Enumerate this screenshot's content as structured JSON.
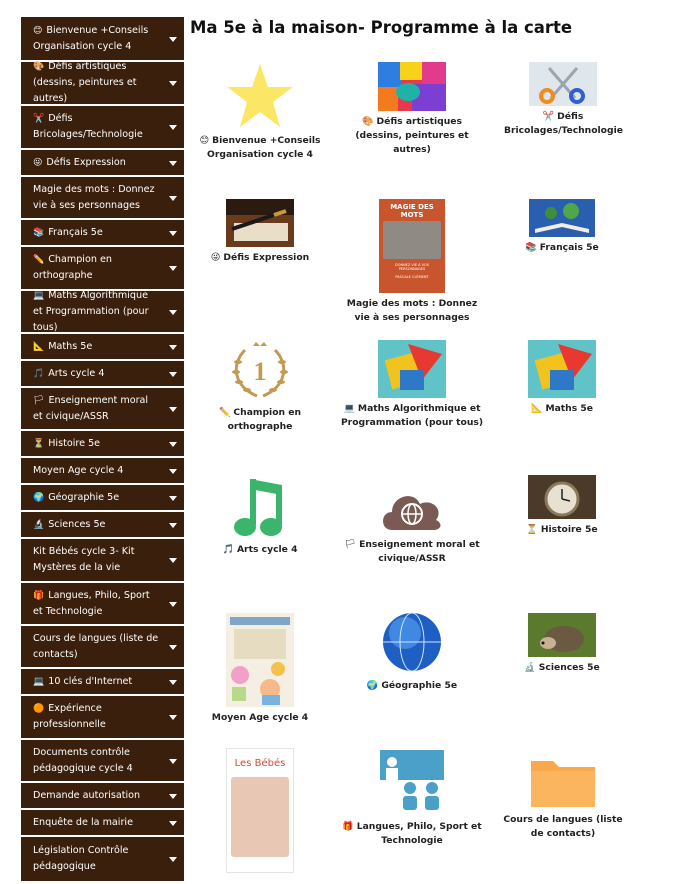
{
  "page": {
    "title": "Ma 5e à la maison- Programme à la carte"
  },
  "sidebar": {
    "items": [
      {
        "icon": "😊",
        "label": "Bienvenue +Conseils Organisation cycle 4"
      },
      {
        "icon": "🎨",
        "label": "Défis artistiques (dessins, peintures et autres)"
      },
      {
        "icon": "✂️",
        "label": "Défis Bricolages/Technologie"
      },
      {
        "icon": "😜",
        "label": "Défis Expression"
      },
      {
        "icon": "",
        "label": "Magie des mots : Donnez vie à ses personnages"
      },
      {
        "icon": "📚",
        "label": "Français 5e"
      },
      {
        "icon": "✏️",
        "label": "Champion en orthographe"
      },
      {
        "icon": "💻",
        "label": "Maths Algorithmique et Programmation (pour tous)"
      },
      {
        "icon": "📐",
        "label": "Maths 5e"
      },
      {
        "icon": "🎵",
        "label": "Arts cycle 4"
      },
      {
        "icon": "🏳",
        "label": "Enseignement moral et civique/ASSR"
      },
      {
        "icon": "⏳",
        "label": "Histoire 5e"
      },
      {
        "icon": "",
        "label": "Moyen Age cycle 4"
      },
      {
        "icon": "🌍",
        "label": "Géographie 5e"
      },
      {
        "icon": "🔬",
        "label": "Sciences 5e"
      },
      {
        "icon": "",
        "label": "Kit Bébés cycle 3- Kit Mystères de la vie"
      },
      {
        "icon": "🎁",
        "label": "Langues, Philo, Sport et Technologie"
      },
      {
        "icon": "",
        "label": "Cours de langues (liste de contacts)"
      },
      {
        "icon": "💻",
        "label": "10 clés d'Internet"
      },
      {
        "icon": "🟠",
        "label": "Expérience professionnelle"
      },
      {
        "icon": "",
        "label": "Documents contrôle pédagogique cycle 4"
      },
      {
        "icon": "",
        "label": "Demande autorisation"
      },
      {
        "icon": "",
        "label": "Enquête de la mairie"
      },
      {
        "icon": "",
        "label": "Législation Contrôle pédagogique"
      }
    ]
  },
  "tiles": [
    {
      "icon": "😊",
      "label": "Bienvenue +Conseils Organisation cycle 4",
      "image": "star-icon"
    },
    {
      "icon": "🎨",
      "label": "Défis artistiques (dessins, peintures et autres)",
      "image": "paint-image"
    },
    {
      "icon": "✂️",
      "label": "Défis Bricolages/Technologie",
      "image": "scissors-image"
    },
    {
      "icon": "😜",
      "label": "Défis Expression",
      "image": "pen-image"
    },
    {
      "icon": "",
      "label": "Magie des mots : Donnez vie à ses personnages",
      "image": "book-cover-image",
      "book_title": "MAGIE DES MOTS",
      "book_sub": "DONNEZ VIE À VOS PERSONNAGES",
      "book_author": "PASCALE CLÉMENT"
    },
    {
      "icon": "📚",
      "label": "Français 5e",
      "image": "open-book-image"
    },
    {
      "icon": "✏️",
      "label": "Champion en orthographe",
      "image": "laurel-medal-icon",
      "medal_text": "1"
    },
    {
      "icon": "💻",
      "label": "Maths Algorithmique et Programmation (pour tous)",
      "image": "geometry-image"
    },
    {
      "icon": "📐",
      "label": "Maths 5e",
      "image": "geometry-image"
    },
    {
      "icon": "🎵",
      "label": "Arts cycle 4",
      "image": "music-note-icon"
    },
    {
      "icon": "🏳",
      "label": "Enseignement moral et civique/ASSR",
      "image": "cloud-globe-icon"
    },
    {
      "icon": "⏳",
      "label": "Histoire 5e",
      "image": "pocket-watch-image"
    },
    {
      "icon": "",
      "label": "Moyen Age cycle 4",
      "image": "medieval-illustration-image"
    },
    {
      "icon": "🌍",
      "label": "Géographie 5e",
      "image": "globe-icon"
    },
    {
      "icon": "🔬",
      "label": "Sciences 5e",
      "image": "hedgehog-image"
    },
    {
      "icon": "",
      "label": "Kit Bébés cycle 3- Kit Mystères de la vie",
      "image": "babies-book-image",
      "cover_title": "Les Bébés"
    },
    {
      "icon": "🎁",
      "label": "Langues, Philo, Sport et Technologie",
      "image": "classroom-icon"
    },
    {
      "icon": "",
      "label": "Cours de langues (liste de contacts)",
      "image": "folder-icon"
    }
  ],
  "colors": {
    "sidebar_bg": "#3a1f0c",
    "sidebar_text": "#ffffff",
    "folder": "#f9a84a",
    "music": "#3bb56b"
  }
}
